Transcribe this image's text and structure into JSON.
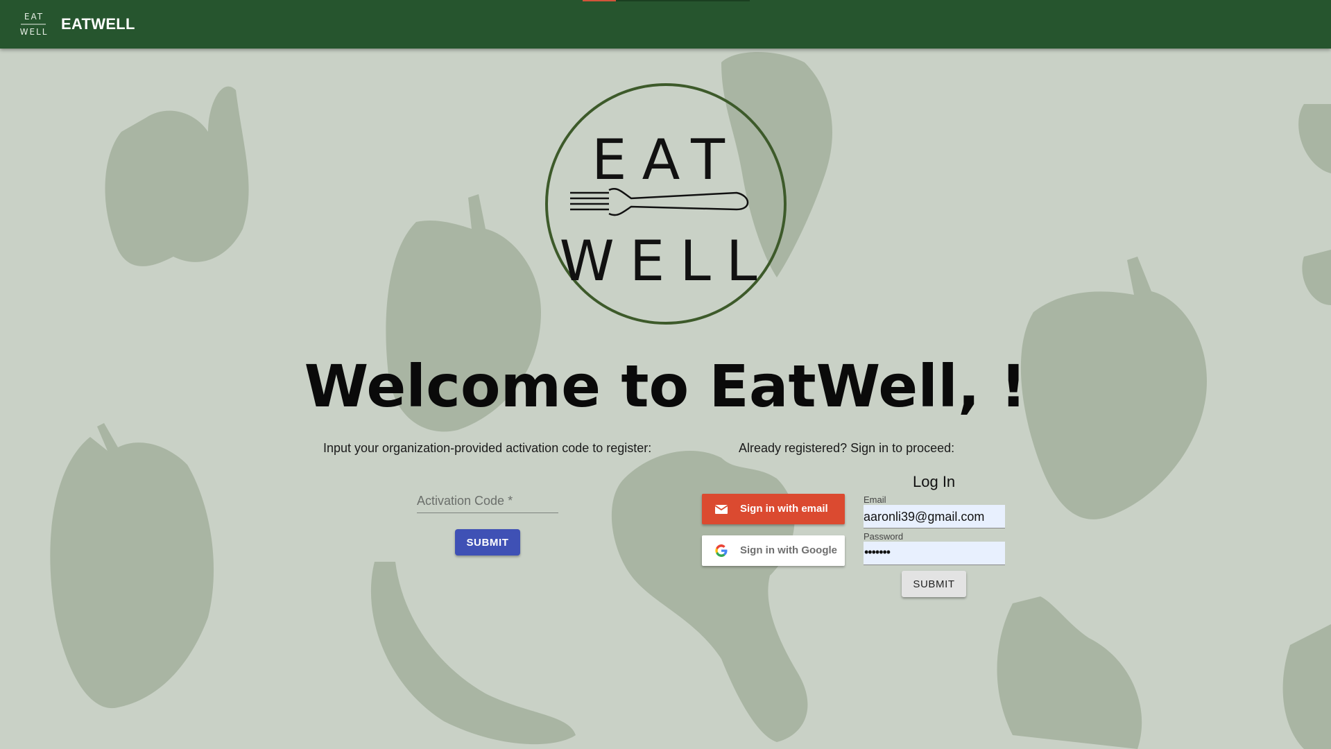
{
  "appbar": {
    "title": "EATWELL",
    "logo_icon": "eatwell-logo-small",
    "logo_text_top": "EAT",
    "logo_text_bottom": "WELL"
  },
  "colors": {
    "appbar": "#26552e",
    "background": "#c9d1c6",
    "veggie": "#a9b5a3",
    "logo_ring": "#3d5a2a",
    "submit_primary": "#3f51b5",
    "email_button": "#db4a30",
    "input_autofill": "#e8f0fe"
  },
  "hero": {
    "logo_icon": "eatwell-fork-logo",
    "logo_text_top": "EAT",
    "logo_text_bottom": "WELL",
    "welcome": "Welcome to EatWell, !"
  },
  "register": {
    "prompt": "Input your organization-provided activation code to register:",
    "activation_label": "Activation Code *",
    "submit_label": "SUBMIT"
  },
  "signin": {
    "prompt": "Already registered? Sign in to proceed:",
    "email_button": "Sign in with email",
    "email_icon": "mail-icon",
    "google_button": "Sign in with Google",
    "google_icon": "google-icon"
  },
  "login": {
    "title": "Log In",
    "email_label": "Email",
    "email_value": "aaronli39@gmail.com",
    "password_label": "Password",
    "password_mask": "•••••••",
    "submit_label": "SUBMIT"
  }
}
